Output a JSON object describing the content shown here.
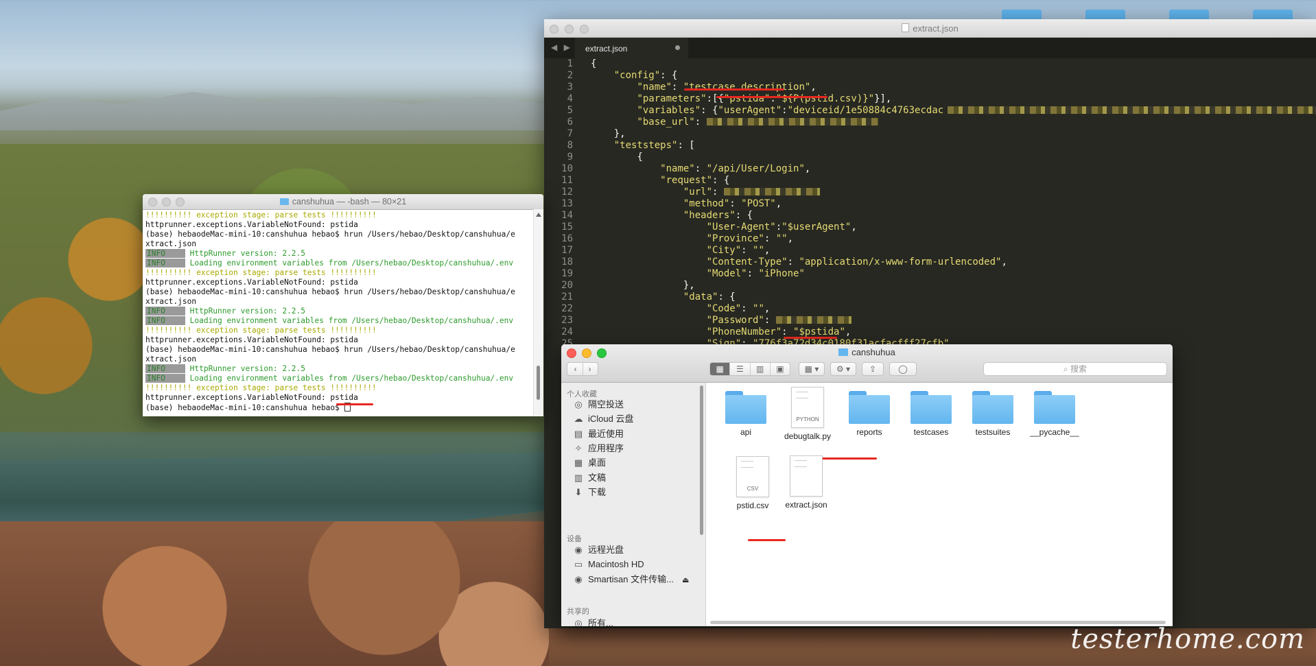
{
  "editor": {
    "window_title": "extract.json",
    "tab_label": "extract.json",
    "line_numbers": [
      "1",
      "2",
      "3",
      "4",
      "5",
      "6",
      "7",
      "8",
      "9",
      "10",
      "11",
      "12",
      "13",
      "14",
      "15",
      "16",
      "17",
      "18",
      "19",
      "20",
      "21",
      "22",
      "23",
      "24",
      "25"
    ],
    "lines": [
      {
        "indent": "",
        "text": "{"
      },
      {
        "indent": "    ",
        "key": "\"config\"",
        "text": ": {"
      },
      {
        "indent": "        ",
        "key": "\"name\"",
        "text": ": ",
        "val": "\"testcase description\"",
        "tail": ","
      },
      {
        "indent": "        ",
        "key": "\"parameters\"",
        "text": ":[{",
        "val": "\"pstida\"",
        "tail": ":",
        "val2": "\"${P(pstid.csv)}\"",
        "tail2": "}],"
      },
      {
        "indent": "        ",
        "key": "\"variables\"",
        "text": ": {",
        "val": "\"userAgent\"",
        "tail": ":",
        "val2": "\"deviceid/1e50884c4763ecdac",
        "blur": true
      },
      {
        "indent": "        ",
        "key": "\"base_url\"",
        "text": ": ",
        "blur2": true
      },
      {
        "indent": "    ",
        "text": "},"
      },
      {
        "indent": "    ",
        "key": "\"teststeps\"",
        "text": ": ["
      },
      {
        "indent": "        ",
        "text": "{"
      },
      {
        "indent": "            ",
        "key": "\"name\"",
        "text": ": ",
        "val": "\"/api/User/Login\"",
        "tail": ","
      },
      {
        "indent": "            ",
        "key": "\"request\"",
        "text": ": {"
      },
      {
        "indent": "                ",
        "key": "\"url\"",
        "text": ": ",
        "blur3": true
      },
      {
        "indent": "                ",
        "key": "\"method\"",
        "text": ": ",
        "val": "\"POST\"",
        "tail": ","
      },
      {
        "indent": "                ",
        "key": "\"headers\"",
        "text": ": {"
      },
      {
        "indent": "                    ",
        "key": "\"User-Agent\"",
        "text": ":",
        "val": "\"$userAgent\"",
        "tail": ","
      },
      {
        "indent": "                    ",
        "key": "\"Province\"",
        "text": ": ",
        "val": "\"\"",
        "tail": ","
      },
      {
        "indent": "                    ",
        "key": "\"City\"",
        "text": ": ",
        "val": "\"\"",
        "tail": ","
      },
      {
        "indent": "                    ",
        "key": "\"Content-Type\"",
        "text": ": ",
        "val": "\"application/x-www-form-urlencoded\"",
        "tail": ","
      },
      {
        "indent": "                    ",
        "key": "\"Model\"",
        "text": ": ",
        "val": "\"iPhone\""
      },
      {
        "indent": "                ",
        "text": "},"
      },
      {
        "indent": "                ",
        "key": "\"data\"",
        "text": ": {"
      },
      {
        "indent": "                    ",
        "key": "\"Code\"",
        "text": ": ",
        "val": "\"\"",
        "tail": ","
      },
      {
        "indent": "                    ",
        "key": "\"Password\"",
        "text": ": ",
        "blur4": true
      },
      {
        "indent": "                    ",
        "key": "\"PhoneNumber\"",
        "text": ": ",
        "val": "\"$pstida\"",
        "tail": ","
      },
      {
        "indent": "                    ",
        "key": "\"Sign\"",
        "text": ": ",
        "val": "\"776f3a72d34c0180f31acfacfff27cfb\""
      }
    ]
  },
  "terminal": {
    "title": "canshuhua — -bash — 80×21",
    "lines": [
      {
        "type": "exc",
        "text": "!!!!!!!!!! exception stage: parse tests !!!!!!!!!!"
      },
      {
        "type": "plain",
        "text": "httprunner.exceptions.VariableNotFound: pstida"
      },
      {
        "type": "plain",
        "text": "(base) hebaodeMac-mini-10:canshuhua hebao$ hrun /Users/hebao/Desktop/canshuhua/e"
      },
      {
        "type": "plain",
        "text": "xtract.json"
      },
      {
        "type": "info",
        "tag": "INFO    ",
        "text": " HttpRunner version: 2.2.5"
      },
      {
        "type": "info",
        "tag": "INFO    ",
        "text": " Loading environment variables from /Users/hebao/Desktop/canshuhua/.env"
      },
      {
        "type": "exc",
        "text": "!!!!!!!!!! exception stage: parse tests !!!!!!!!!!"
      },
      {
        "type": "plain",
        "text": "httprunner.exceptions.VariableNotFound: pstida"
      },
      {
        "type": "plain",
        "text": "(base) hebaodeMac-mini-10:canshuhua hebao$ hrun /Users/hebao/Desktop/canshuhua/e"
      },
      {
        "type": "plain",
        "text": "xtract.json"
      },
      {
        "type": "info",
        "tag": "INFO    ",
        "text": " HttpRunner version: 2.2.5"
      },
      {
        "type": "info",
        "tag": "INFO    ",
        "text": " Loading environment variables from /Users/hebao/Desktop/canshuhua/.env"
      },
      {
        "type": "exc",
        "text": "!!!!!!!!!! exception stage: parse tests !!!!!!!!!!"
      },
      {
        "type": "plain",
        "text": "httprunner.exceptions.VariableNotFound: pstida"
      },
      {
        "type": "plain",
        "text": "(base) hebaodeMac-mini-10:canshuhua hebao$ hrun /Users/hebao/Desktop/canshuhua/e"
      },
      {
        "type": "plain",
        "text": "xtract.json"
      },
      {
        "type": "info",
        "tag": "INFO    ",
        "text": " HttpRunner version: 2.2.5"
      },
      {
        "type": "info",
        "tag": "INFO    ",
        "text": " Loading environment variables from /Users/hebao/Desktop/canshuhua/.env"
      },
      {
        "type": "exc",
        "text": "!!!!!!!!!! exception stage: parse tests !!!!!!!!!!"
      },
      {
        "type": "plain",
        "text": "httprunner.exceptions.VariableNotFound: pstida"
      },
      {
        "type": "prompt",
        "text": "(base) hebaodeMac-mini-10:canshuhua hebao$ "
      }
    ]
  },
  "finder": {
    "title": "canshuhua",
    "search_placeholder": "搜索",
    "sections": {
      "favorites": "个人收藏",
      "devices": "设备",
      "shared": "共享的"
    },
    "favorites": [
      {
        "icon": "airdrop-icon",
        "glyph": "◎",
        "label": "隔空投送"
      },
      {
        "icon": "icloud-icon",
        "glyph": "☁",
        "label": "iCloud 云盘"
      },
      {
        "icon": "recents-icon",
        "glyph": "▤",
        "label": "最近使用"
      },
      {
        "icon": "applications-icon",
        "glyph": "✧",
        "label": "应用程序"
      },
      {
        "icon": "desktop-icon",
        "glyph": "▦",
        "label": "桌面"
      },
      {
        "icon": "documents-icon",
        "glyph": "▥",
        "label": "文稿"
      },
      {
        "icon": "downloads-icon",
        "glyph": "⬇",
        "label": "下载"
      }
    ],
    "devices": [
      {
        "icon": "remote-disc-icon",
        "glyph": "◉",
        "label": "远程光盘"
      },
      {
        "icon": "hard-drive-icon",
        "glyph": "▭",
        "label": "Macintosh HD"
      },
      {
        "icon": "drive-icon",
        "glyph": "◉",
        "label": "Smartisan 文件传输...",
        "eject": "⏏"
      }
    ],
    "shared": [
      {
        "icon": "network-icon",
        "glyph": "◎",
        "label": "所有..."
      }
    ],
    "files": [
      {
        "kind": "folder",
        "label": "api"
      },
      {
        "kind": "doc",
        "tag": "PYTHON",
        "label": "debugtalk.py"
      },
      {
        "kind": "folder",
        "label": "reports"
      },
      {
        "kind": "folder",
        "label": "testcases"
      },
      {
        "kind": "folder",
        "label": "testsuites"
      },
      {
        "kind": "folder",
        "label": "__pycache__"
      },
      {
        "kind": "doc",
        "tag": "CSV",
        "label": "pstid.csv"
      },
      {
        "kind": "doc",
        "tag": "",
        "label": "extract.json"
      }
    ]
  },
  "watermark": "testerhome.com"
}
